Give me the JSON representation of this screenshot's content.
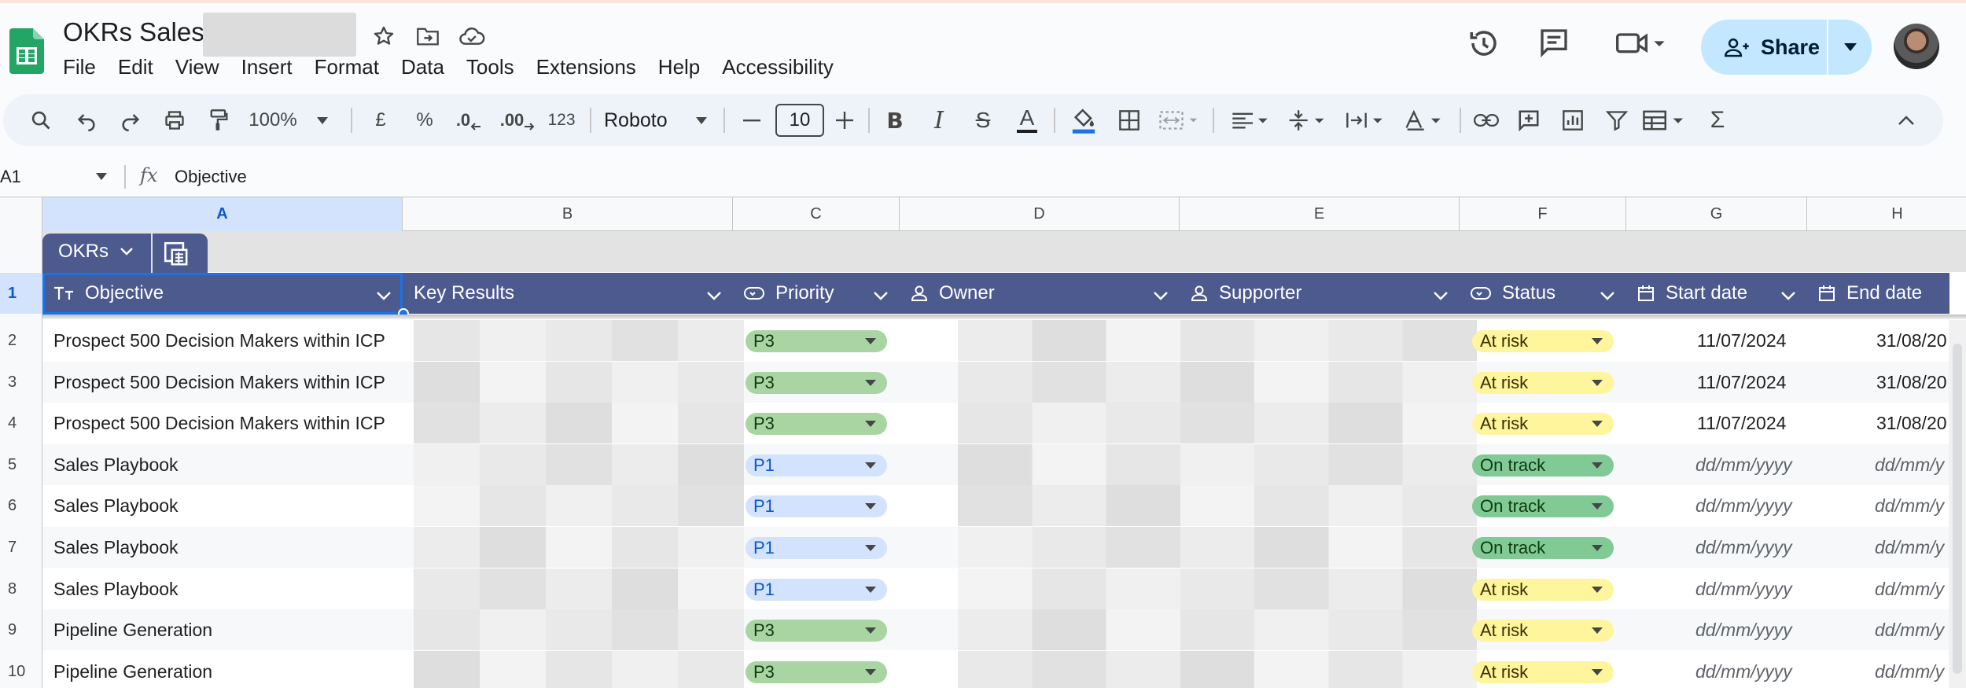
{
  "doc": {
    "title": "OKRs Sales -"
  },
  "menu": [
    "File",
    "Edit",
    "View",
    "Insert",
    "Format",
    "Data",
    "Tools",
    "Extensions",
    "Help",
    "Accessibility"
  ],
  "share": {
    "label": "Share"
  },
  "toolbar": {
    "zoom": "100%",
    "currency": "£",
    "percent": "%",
    "dec_less": ".0",
    "dec_more": ".00",
    "number_format": "123",
    "font": "Roboto",
    "font_size": "10"
  },
  "formula": {
    "cell_ref": "A1",
    "fx": "fx",
    "value": "Objective"
  },
  "columns": [
    "A",
    "B",
    "C",
    "D",
    "E",
    "F",
    "G",
    "H"
  ],
  "table": {
    "tab_name": "OKRs",
    "headers": [
      "Objective",
      "Key Results",
      "Priority",
      "Owner",
      "Supporter",
      "Status",
      "Start date",
      "End date"
    ],
    "rows": [
      {
        "num": "2",
        "objective": "Prospect 500 Decision Makers within ICP",
        "priority": "P3",
        "status": "At risk",
        "start": "11/07/2024",
        "end": "31/08/20"
      },
      {
        "num": "3",
        "objective": "Prospect 500 Decision Makers within ICP",
        "priority": "P3",
        "status": "At risk",
        "start": "11/07/2024",
        "end": "31/08/20"
      },
      {
        "num": "4",
        "objective": "Prospect 500 Decision Makers within ICP",
        "priority": "P3",
        "status": "At risk",
        "start": "11/07/2024",
        "end": "31/08/20"
      },
      {
        "num": "5",
        "objective": "Sales Playbook",
        "priority": "P1",
        "status": "On track",
        "start": "dd/mm/yyyy",
        "end": "dd/mm/y"
      },
      {
        "num": "6",
        "objective": "Sales Playbook",
        "priority": "P1",
        "status": "On track",
        "start": "dd/mm/yyyy",
        "end": "dd/mm/y"
      },
      {
        "num": "7",
        "objective": "Sales Playbook",
        "priority": "P1",
        "status": "On track",
        "start": "dd/mm/yyyy",
        "end": "dd/mm/y"
      },
      {
        "num": "8",
        "objective": "Sales Playbook",
        "priority": "P1",
        "status": "At risk",
        "start": "dd/mm/yyyy",
        "end": "dd/mm/y"
      },
      {
        "num": "9",
        "objective": "Pipeline Generation",
        "priority": "P3",
        "status": "At risk",
        "start": "dd/mm/yyyy",
        "end": "dd/mm/y"
      },
      {
        "num": "10",
        "objective": "Pipeline Generation",
        "priority": "P3",
        "status": "At risk",
        "start": "dd/mm/yyyy",
        "end": "dd/mm/y"
      }
    ]
  },
  "header_row_num": "1",
  "colors": {
    "table_header": "#4d5a8e",
    "p3_chip": "#a8d5a2",
    "p1_chip": "#d3e3fd",
    "at_risk": "#fff59d",
    "on_track": "#81c995",
    "accent": "#1a73e8",
    "share_bg": "#c2e7ff"
  }
}
